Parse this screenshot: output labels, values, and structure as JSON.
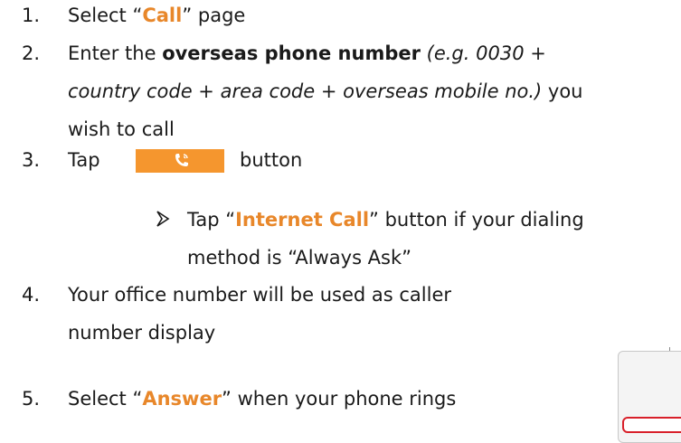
{
  "steps": [
    {
      "num": "1.",
      "pre": "Select “",
      "hl": "Call",
      "post": "” page"
    },
    {
      "num": "2.",
      "pre": "Enter the ",
      "bold": "overseas phone number",
      "italic1": " (e.g. 0030 +",
      "italic2": "country code + area code + overseas mobile no.)",
      "post": " you",
      "line3": "wish to call"
    },
    {
      "num": "3.",
      "pre": "Tap",
      "post": "button",
      "sub_pre": "Tap “",
      "sub_hl": "Internet Call",
      "sub_post": "” button if your dialing",
      "sub_line2": "method is “Always Ask”"
    },
    {
      "num": "4.",
      "line1": "Your office number will be used as caller",
      "line2": "number display"
    },
    {
      "num": "5.",
      "pre": "Select “",
      "hl": "Answer",
      "post": "” when your phone rings"
    }
  ],
  "colors": {
    "highlight": "#e8872a",
    "call_button": "#f5962e",
    "phone_red": "#d8202a"
  },
  "icons": {
    "call_button_icon": "phone-wifi-icon",
    "bullet": "arrow-bullet-icon"
  }
}
